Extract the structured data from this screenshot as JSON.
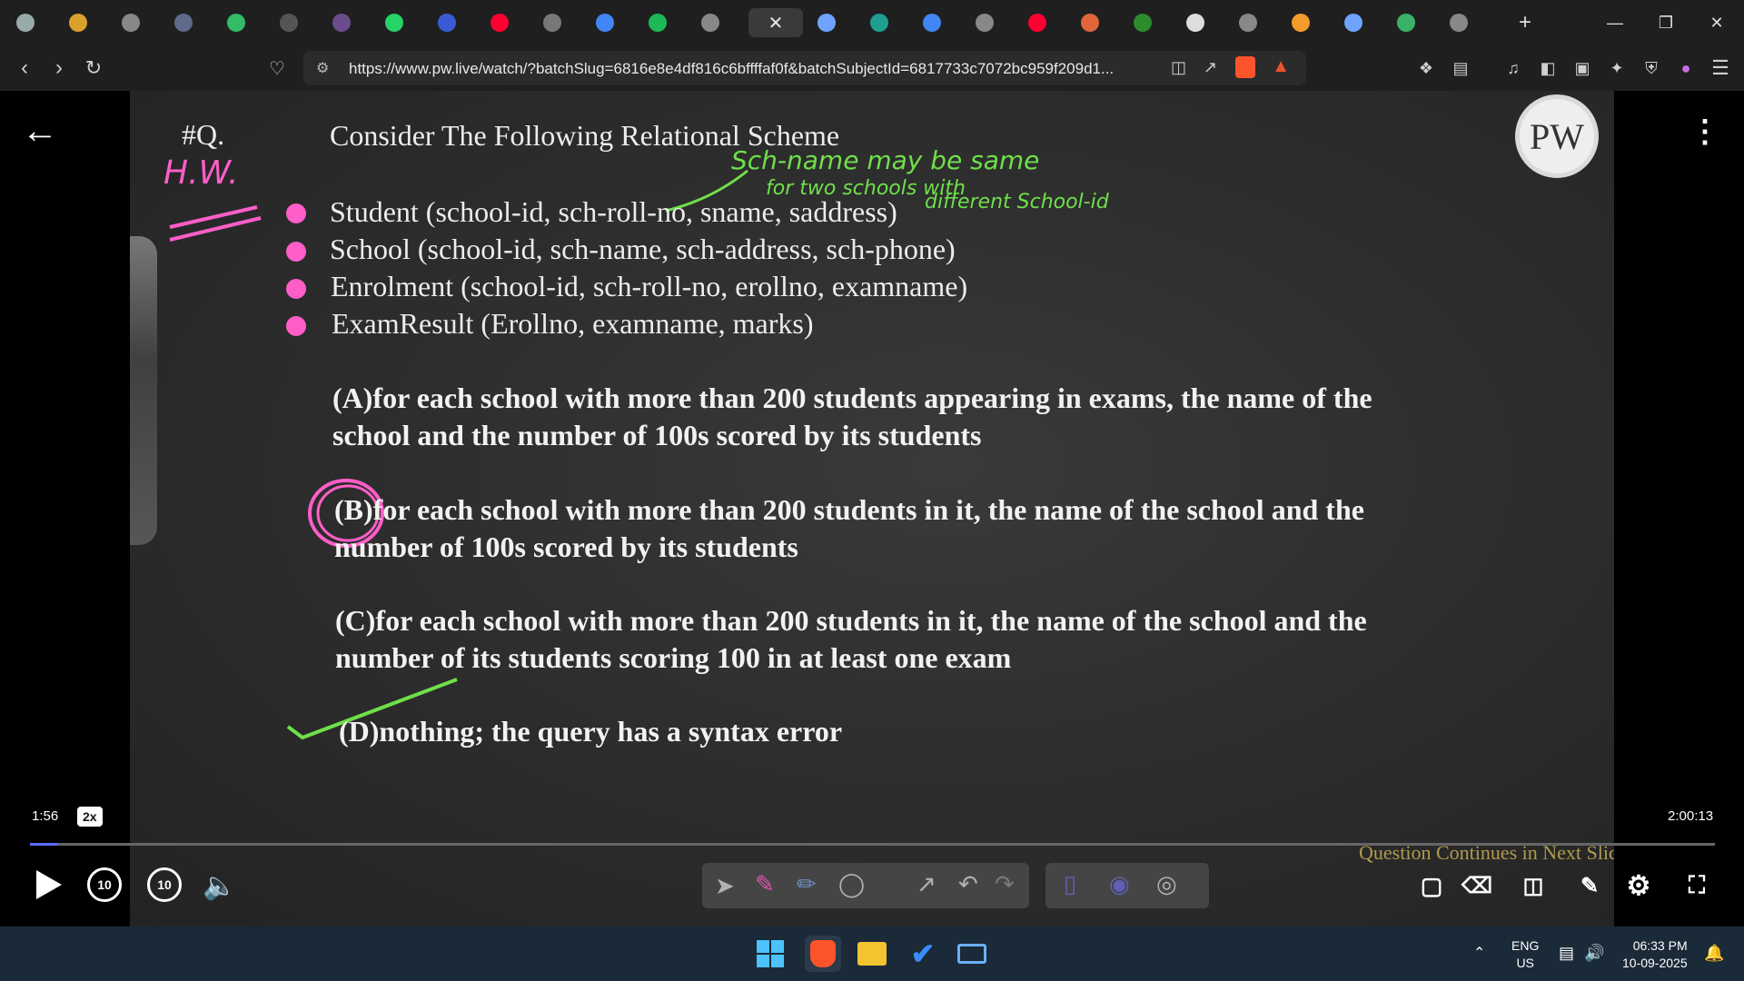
{
  "browser": {
    "url": "https://www.pw.live/watch/?batchSlug=6816e8e4df816c6bffffaf0f&batchSubjectId=6817733c7072bc959f209d1...",
    "tabs": [
      {
        "icon": "chatgpt-icon",
        "color": "#9aa"
      },
      {
        "icon": "site-icon",
        "color": "#d9a12c"
      },
      {
        "icon": "openai-icon",
        "color": "#888"
      },
      {
        "icon": "site-icon",
        "color": "#5f6b8a"
      },
      {
        "icon": "w3schools-icon",
        "color": "#3b6"
      },
      {
        "icon": "site-icon",
        "color": "#555"
      },
      {
        "icon": "site-icon",
        "color": "#6a4c8c"
      },
      {
        "icon": "whatsapp-icon",
        "color": "#25d366"
      },
      {
        "icon": "site-icon",
        "color": "#3b5bd6"
      },
      {
        "icon": "youtube-icon",
        "color": "#ff0033"
      },
      {
        "icon": "unacademy-icon",
        "color": "#777"
      },
      {
        "icon": "google-icon",
        "color": "#4285f4"
      },
      {
        "icon": "spotify-icon",
        "color": "#1db954"
      },
      {
        "icon": "site-icon",
        "color": "#888"
      },
      {
        "icon": "active-tab",
        "color": "#3a3a3a"
      },
      {
        "icon": "gemini-icon",
        "color": "#6fa3ff"
      },
      {
        "icon": "site-icon",
        "color": "#1e9e8f"
      },
      {
        "icon": "google-icon",
        "color": "#4285f4"
      },
      {
        "icon": "site-icon",
        "color": "#888"
      },
      {
        "icon": "youtube-icon",
        "color": "#ff0033"
      },
      {
        "icon": "site-icon",
        "color": "#e0663a"
      },
      {
        "icon": "site-icon",
        "color": "#2d8a2d"
      },
      {
        "icon": "wikipedia-icon",
        "color": "#ddd"
      },
      {
        "icon": "site-icon",
        "color": "#888"
      },
      {
        "icon": "site-icon",
        "color": "#f39c2b"
      },
      {
        "icon": "gemini-icon",
        "color": "#6fa3ff"
      },
      {
        "icon": "site-icon",
        "color": "#3bb26a"
      },
      {
        "icon": "site-icon",
        "color": "#888"
      }
    ],
    "active_tab_close": "✕",
    "new_tab": "+"
  },
  "slide": {
    "q_label": "#Q.",
    "hw_note": "H.W.",
    "title": "Consider The Following Relational Scheme",
    "relations": [
      "Student (school-id, sch-roll-no, sname, saddress)",
      "School (school-id, sch-name, sch-address, sch-phone)",
      "Enrolment (school-id, sch-roll-no, erollno, examname)",
      "ExamResult (Erollno, examname, marks)"
    ],
    "hand_note_1": "Sch-name may be same",
    "hand_note_2": "for two schools with",
    "hand_note_3": "different School-id",
    "options": [
      {
        "line1": "(A)for each school with more than 200 students appearing in exams, the name of the",
        "line2": "school and the number of 100s scored by its students"
      },
      {
        "line1": "(B)for each school with more than 200 students in it, the name of the school and the",
        "line2": "number of 100s scored by its students"
      },
      {
        "line1": "(C)for each school with more than 200 students in it, the name of the school and the",
        "line2": "number of its students scoring 100 in at least one exam"
      },
      {
        "line1": "(D)nothing; the query has a syntax error",
        "line2": ""
      }
    ],
    "logo_text": "PW",
    "footer_note": "Question Continues in Next Slide"
  },
  "player": {
    "current_time": "1:56",
    "duration": "2:00:13",
    "speed": "2x",
    "progress": 0.016,
    "rewind_label": "10",
    "forward_label": "10",
    "accent": "#5b6bff"
  },
  "taskbar": {
    "lang_1": "ENG",
    "lang_2": "US",
    "time": "06:33 PM",
    "date": "10-09-2025"
  }
}
